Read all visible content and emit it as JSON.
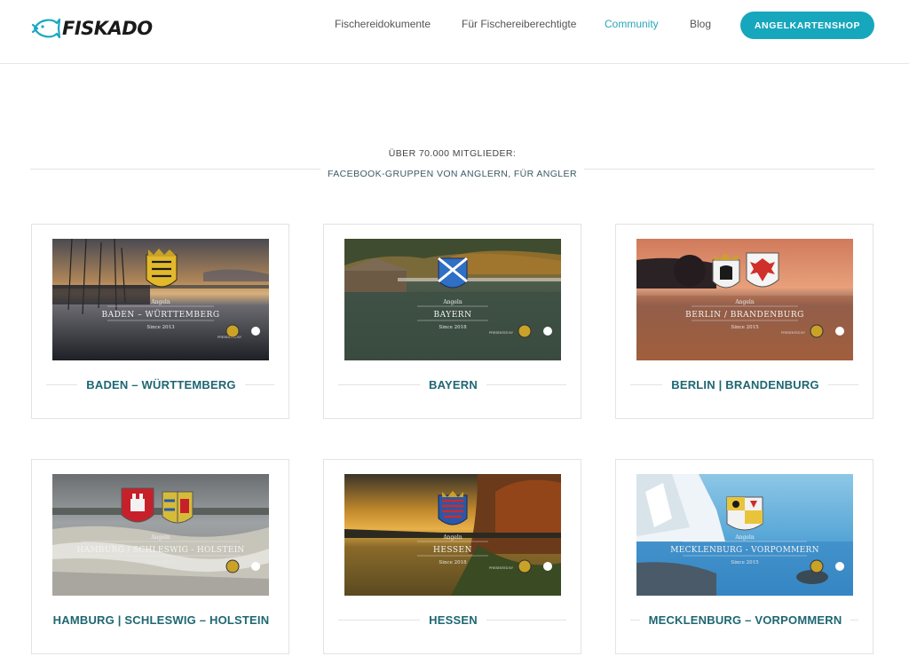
{
  "header": {
    "logo_text": "FISKADO",
    "nav": [
      {
        "label": "Fischereidokumente",
        "active": false
      },
      {
        "label": "Für Fischereiberechtigte",
        "active": false
      },
      {
        "label": "Community",
        "active": true
      },
      {
        "label": "Blog",
        "active": false
      }
    ],
    "shop_button": "ANGELKARTENSHOP"
  },
  "intro": {
    "line1": "ÜBER 70.000 MITGLIEDER:",
    "line2": "FACEBOOK-GRUPPEN VON ANGLERN, FÜR ANGLER"
  },
  "cards": [
    {
      "title": "BADEN – WÜRTTEMBERG",
      "overlay_kicker": "Angeln",
      "overlay_name": "BADEN – WÜRTTEMBERG",
      "overlay_since": "Since 2013"
    },
    {
      "title": "BAYERN",
      "overlay_kicker": "Angeln",
      "overlay_name": "BAYERN",
      "overlay_since": "Since 2018"
    },
    {
      "title": "BERLIN | BRANDENBURG",
      "overlay_kicker": "Angeln",
      "overlay_name": "BERLIN / BRANDENBURG",
      "overlay_since": "Since 2015"
    },
    {
      "title": "HAMBURG | SCHLESWIG – HOLSTEIN",
      "overlay_kicker": "Angeln",
      "overlay_name": "HAMBURG / SCHLESWIG - HOLSTEIN",
      "overlay_since": "Since 2017"
    },
    {
      "title": "HESSEN",
      "overlay_kicker": "Angeln",
      "overlay_name": "HESSEN",
      "overlay_since": "Since 2018"
    },
    {
      "title": "MECKLENBURG – VORPOMMERN",
      "overlay_kicker": "Angeln",
      "overlay_name": "MECKLENBURG - VORPOMMERN",
      "overlay_since": "Since 2015"
    }
  ],
  "overlay_presented_by": "PRESENTED BY",
  "colors": {
    "accent": "#17a7bd",
    "nav_active": "#2aa6b8",
    "card_title": "#1e6772"
  }
}
